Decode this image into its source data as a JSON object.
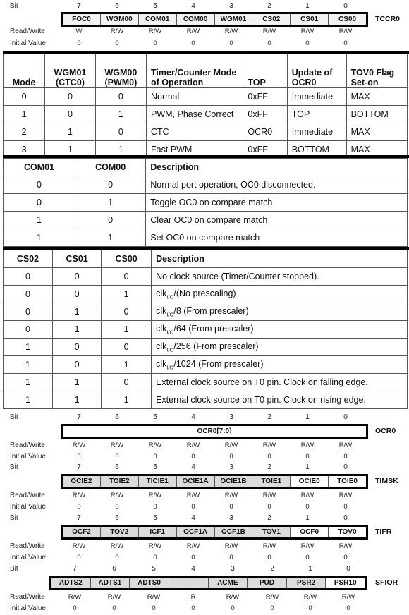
{
  "row_labels": {
    "bit": "Bit",
    "read_write": "Read/Write",
    "initial_value": "Initial Value"
  },
  "bit_numbers": [
    "7",
    "6",
    "5",
    "4",
    "3",
    "2",
    "1",
    "0"
  ],
  "registers": {
    "tccr0": {
      "name": "TCCR0",
      "bits": [
        "FOC0",
        "WGM00",
        "COM01",
        "COM00",
        "WGM01",
        "CS02",
        "CS01",
        "CS00"
      ],
      "access": [
        "W",
        "R/W",
        "R/W",
        "R/W",
        "R/W",
        "R/W",
        "R/W",
        "R/W"
      ],
      "initial": [
        "0",
        "0",
        "0",
        "0",
        "0",
        "0",
        "0",
        "0"
      ]
    },
    "ocr0": {
      "name": "OCR0",
      "field": "OCR0[7:0]",
      "access": [
        "R/W",
        "R/W",
        "R/W",
        "R/W",
        "R/W",
        "R/W",
        "R/W",
        "R/W"
      ],
      "initial": [
        "0",
        "0",
        "0",
        "0",
        "0",
        "0",
        "0",
        "0"
      ]
    },
    "timsk": {
      "name": "TIMSK",
      "bits": [
        "OCIE2",
        "TOIE2",
        "TICIE1",
        "OCIE1A",
        "OCIE1B",
        "TOIE1",
        "OCIE0",
        "TOIE0"
      ],
      "access": [
        "R/W",
        "R/W",
        "R/W",
        "R/W",
        "R/W",
        "R/W",
        "R/W",
        "R/W"
      ],
      "initial": [
        "0",
        "0",
        "0",
        "0",
        "0",
        "0",
        "0",
        "0"
      ]
    },
    "tifr": {
      "name": "TIFR",
      "bits": [
        "OCF2",
        "TOV2",
        "ICF1",
        "OCF1A",
        "OCF1B",
        "TOV1",
        "OCF0",
        "TOV0"
      ],
      "access": [
        "R/W",
        "R/W",
        "R/W",
        "R/W",
        "R/W",
        "R/W",
        "R/W",
        "R/W"
      ],
      "initial": [
        "0",
        "0",
        "0",
        "0",
        "0",
        "0",
        "0",
        "0"
      ]
    },
    "sfior": {
      "name": "SFIOR",
      "bits": [
        "ADTS2",
        "ADTS1",
        "ADTS0",
        "–",
        "ACME",
        "PUD",
        "PSR2",
        "PSR10"
      ],
      "access": [
        "R/W",
        "R/W",
        "R/W",
        "R",
        "R/W",
        "R/W",
        "R/W",
        "R/W"
      ],
      "initial": [
        "0",
        "0",
        "0",
        "0",
        "0",
        "0",
        "0",
        "0"
      ]
    }
  },
  "mode_table": {
    "headers": [
      "Mode",
      "WGM01 (CTC0)",
      "WGM00 (PWM0)",
      "Timer/Counter Mode of Operation",
      "TOP",
      "Update of OCR0",
      "TOV0 Flag Set-on"
    ],
    "header_lines": [
      [
        "Mode"
      ],
      [
        "WGM01",
        "(CTC0)"
      ],
      [
        "WGM00",
        "(PWM0)"
      ],
      [
        "Timer/Counter Mode",
        "of Operation"
      ],
      [
        "TOP"
      ],
      [
        "Update of",
        "OCR0"
      ],
      [
        "TOV0 Flag",
        "Set-on"
      ]
    ],
    "rows": [
      [
        "0",
        "0",
        "0",
        "Normal",
        "0xFF",
        "Immediate",
        "MAX"
      ],
      [
        "1",
        "0",
        "1",
        "PWM, Phase Correct",
        "0xFF",
        "TOP",
        "BOTTOM"
      ],
      [
        "2",
        "1",
        "0",
        "CTC",
        "OCR0",
        "Immediate",
        "MAX"
      ],
      [
        "3",
        "1",
        "1",
        "Fast PWM",
        "0xFF",
        "BOTTOM",
        "MAX"
      ]
    ]
  },
  "com_table": {
    "headers": [
      "COM01",
      "COM00",
      "Description"
    ],
    "rows": [
      [
        "0",
        "0",
        "Normal port operation, OC0 disconnected."
      ],
      [
        "0",
        "1",
        "Toggle OC0 on compare match"
      ],
      [
        "1",
        "0",
        "Clear OC0 on compare match"
      ],
      [
        "1",
        "1",
        "Set OC0 on compare match"
      ]
    ]
  },
  "cs_table": {
    "headers": [
      "CS02",
      "CS01",
      "CS00",
      "Description"
    ],
    "clk_prefix": "clk",
    "clk_sub": "I/O",
    "rows": [
      {
        "cs02": "0",
        "cs01": "0",
        "cs00": "0",
        "clk": false,
        "desc": "No clock source (Timer/Counter stopped)."
      },
      {
        "cs02": "0",
        "cs01": "0",
        "cs00": "1",
        "clk": true,
        "desc": "/(No prescaling)"
      },
      {
        "cs02": "0",
        "cs01": "1",
        "cs00": "0",
        "clk": true,
        "desc": "/8 (From prescaler)"
      },
      {
        "cs02": "0",
        "cs01": "1",
        "cs00": "1",
        "clk": true,
        "desc": "/64 (From prescaler)"
      },
      {
        "cs02": "1",
        "cs01": "0",
        "cs00": "0",
        "clk": true,
        "desc": "/256 (From prescaler)"
      },
      {
        "cs02": "1",
        "cs01": "0",
        "cs00": "1",
        "clk": true,
        "desc": "/1024 (From prescaler)"
      },
      {
        "cs02": "1",
        "cs01": "1",
        "cs00": "0",
        "clk": false,
        "desc": "External clock source on T0 pin. Clock on falling edge."
      },
      {
        "cs02": "1",
        "cs01": "1",
        "cs00": "1",
        "clk": false,
        "desc": "External clock source on T0 pin. Clock on rising edge."
      }
    ]
  }
}
